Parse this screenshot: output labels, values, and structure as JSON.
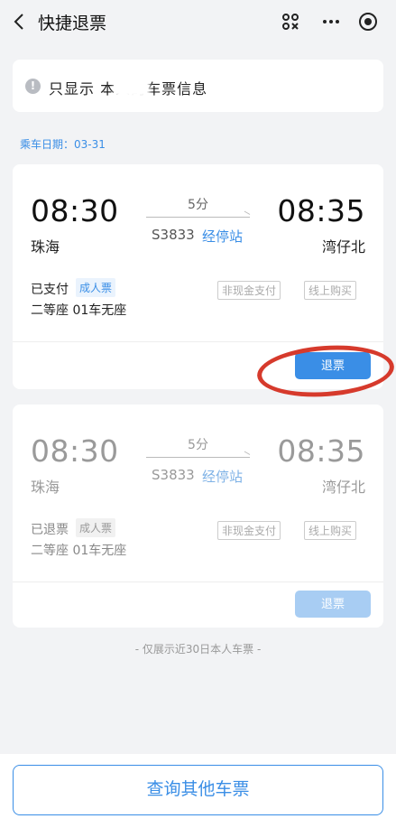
{
  "header": {
    "title": "快捷退票"
  },
  "notice": {
    "text": "只显示 本人的车票信息"
  },
  "ride_date": "乘车日期：03-31",
  "tickets": [
    {
      "dep_time": "08:30",
      "arr_time": "08:35",
      "dep_station": "珠海",
      "arr_station": "湾仔北",
      "duration": "5分",
      "train_no": "S3833",
      "via_label": "经停站",
      "status": "已支付",
      "ticket_type": "成人票",
      "seat": "二等座  01车无座",
      "payment_tag": "非现金支付",
      "purchase_tag": "线上购买",
      "refund_label": "退票"
    },
    {
      "dep_time": "08:30",
      "arr_time": "08:35",
      "dep_station": "珠海",
      "arr_station": "湾仔北",
      "duration": "5分",
      "train_no": "S3833",
      "via_label": "经停站",
      "status": "已退票",
      "ticket_type": "成人票",
      "seat": "二等座  01车无座",
      "payment_tag": "非现金支付",
      "purchase_tag": "线上购买",
      "refund_label": "退票"
    }
  ],
  "footer_note": "- 仅展示近30日本人车票 -",
  "query_button": "查询其他车票",
  "colors": {
    "accent": "#3a8ee6",
    "highlight_circle": "#d63a2c"
  }
}
